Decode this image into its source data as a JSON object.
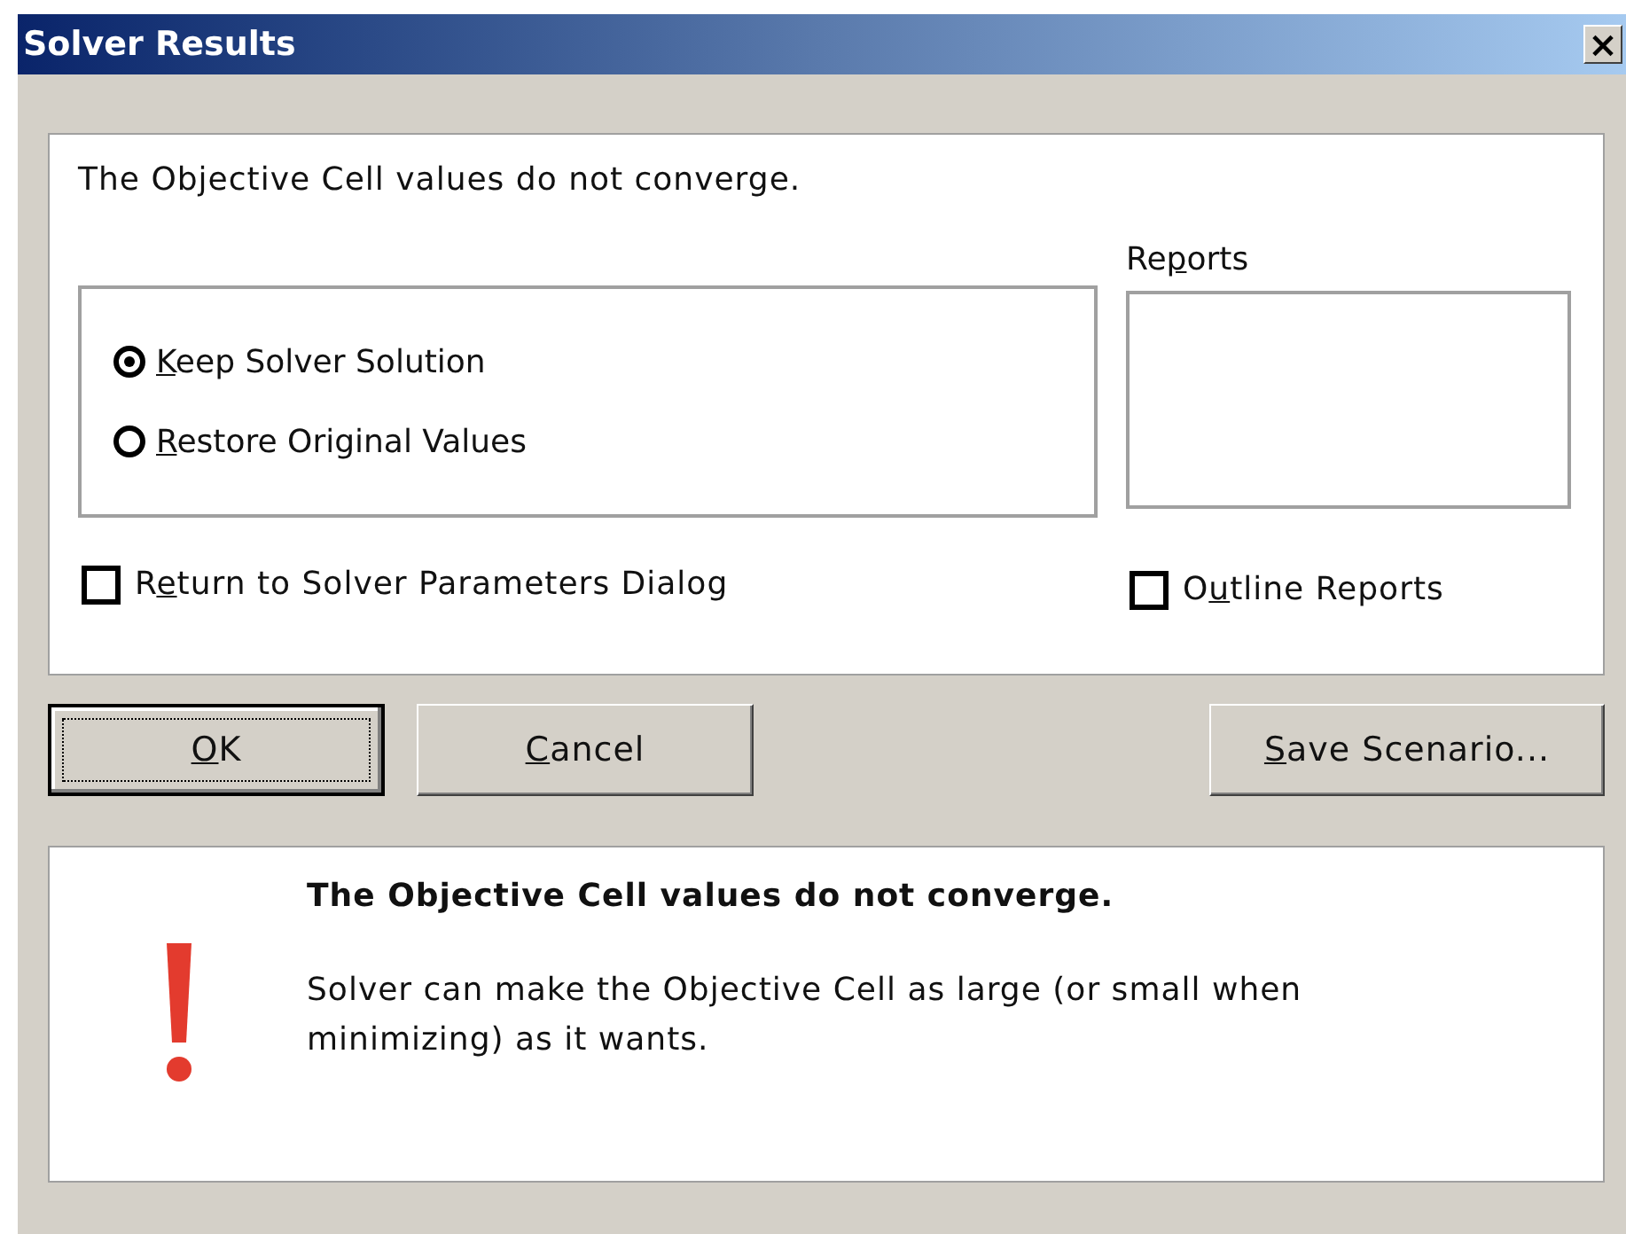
{
  "window": {
    "title": "Solver Results",
    "close": "×"
  },
  "message": "The Objective Cell values do not converge.",
  "options": [
    {
      "label": {
        "key": "K",
        "after": "eep Solver Solution"
      },
      "selected": true
    },
    {
      "label": {
        "key": "R",
        "after": "estore Original Values"
      },
      "selected": false
    }
  ],
  "return_checkbox": {
    "label": {
      "before": "R",
      "key": "e",
      "after": "turn to Solver Parameters Dialog"
    },
    "checked": false
  },
  "reports": {
    "label": {
      "before": "Re",
      "key": "p",
      "after": "orts"
    }
  },
  "outline_checkbox": {
    "label": {
      "before": "O",
      "key": "u",
      "after": "tline Reports"
    },
    "checked": false
  },
  "buttons": [
    {
      "label": {
        "key": "O",
        "after": "K"
      },
      "focused": true
    },
    {
      "label": {
        "key": "C",
        "after": "ancel"
      },
      "focused": false
    },
    {
      "label": {
        "key": "S",
        "after": "ave Scenario..."
      },
      "focused": false
    }
  ],
  "info": {
    "heading": "The Objective Cell values do not converge.",
    "body": "Solver can make the Objective Cell as large (or small when minimizing) as it wants."
  }
}
